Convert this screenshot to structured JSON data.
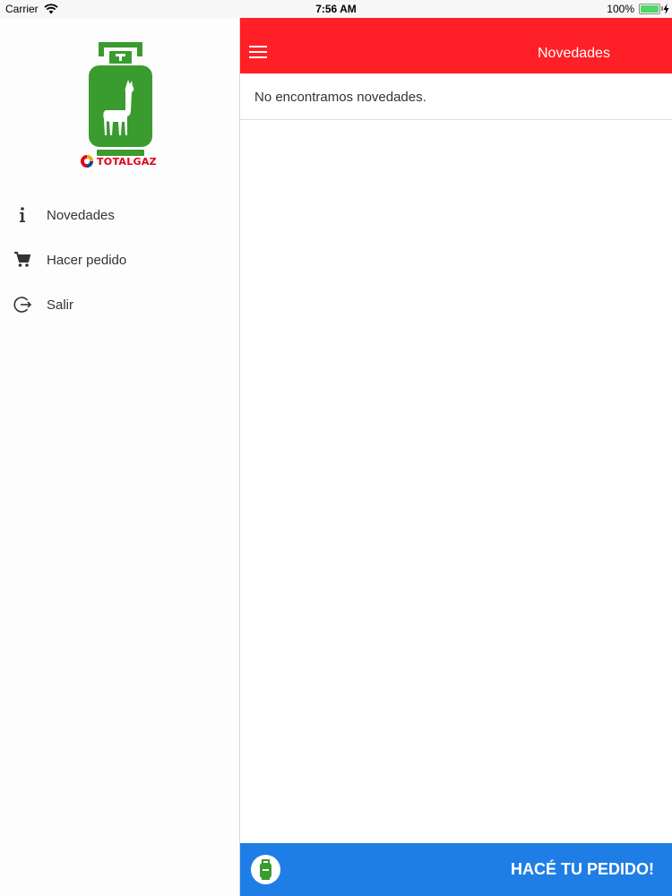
{
  "status_bar": {
    "carrier": "Carrier",
    "time": "7:56 AM",
    "battery": "100%"
  },
  "sidebar": {
    "brand": "TOTALGAZ",
    "items": [
      {
        "label": "Novedades",
        "icon": "info-icon"
      },
      {
        "label": "Hacer pedido",
        "icon": "cart-icon"
      },
      {
        "label": "Salir",
        "icon": "logout-icon"
      }
    ]
  },
  "header": {
    "title": "Novedades",
    "menu_icon": "hamburger-icon"
  },
  "main": {
    "empty_message": "No encontramos novedades."
  },
  "order_bar": {
    "label": "HACÉ TU PEDIDO!",
    "icon": "gas-cylinder-icon"
  },
  "colors": {
    "header_bg": "#ff1f26",
    "order_bar_bg": "#1f7ee6",
    "logo_green": "#3a9b2e",
    "brand_red": "#e3001b"
  }
}
